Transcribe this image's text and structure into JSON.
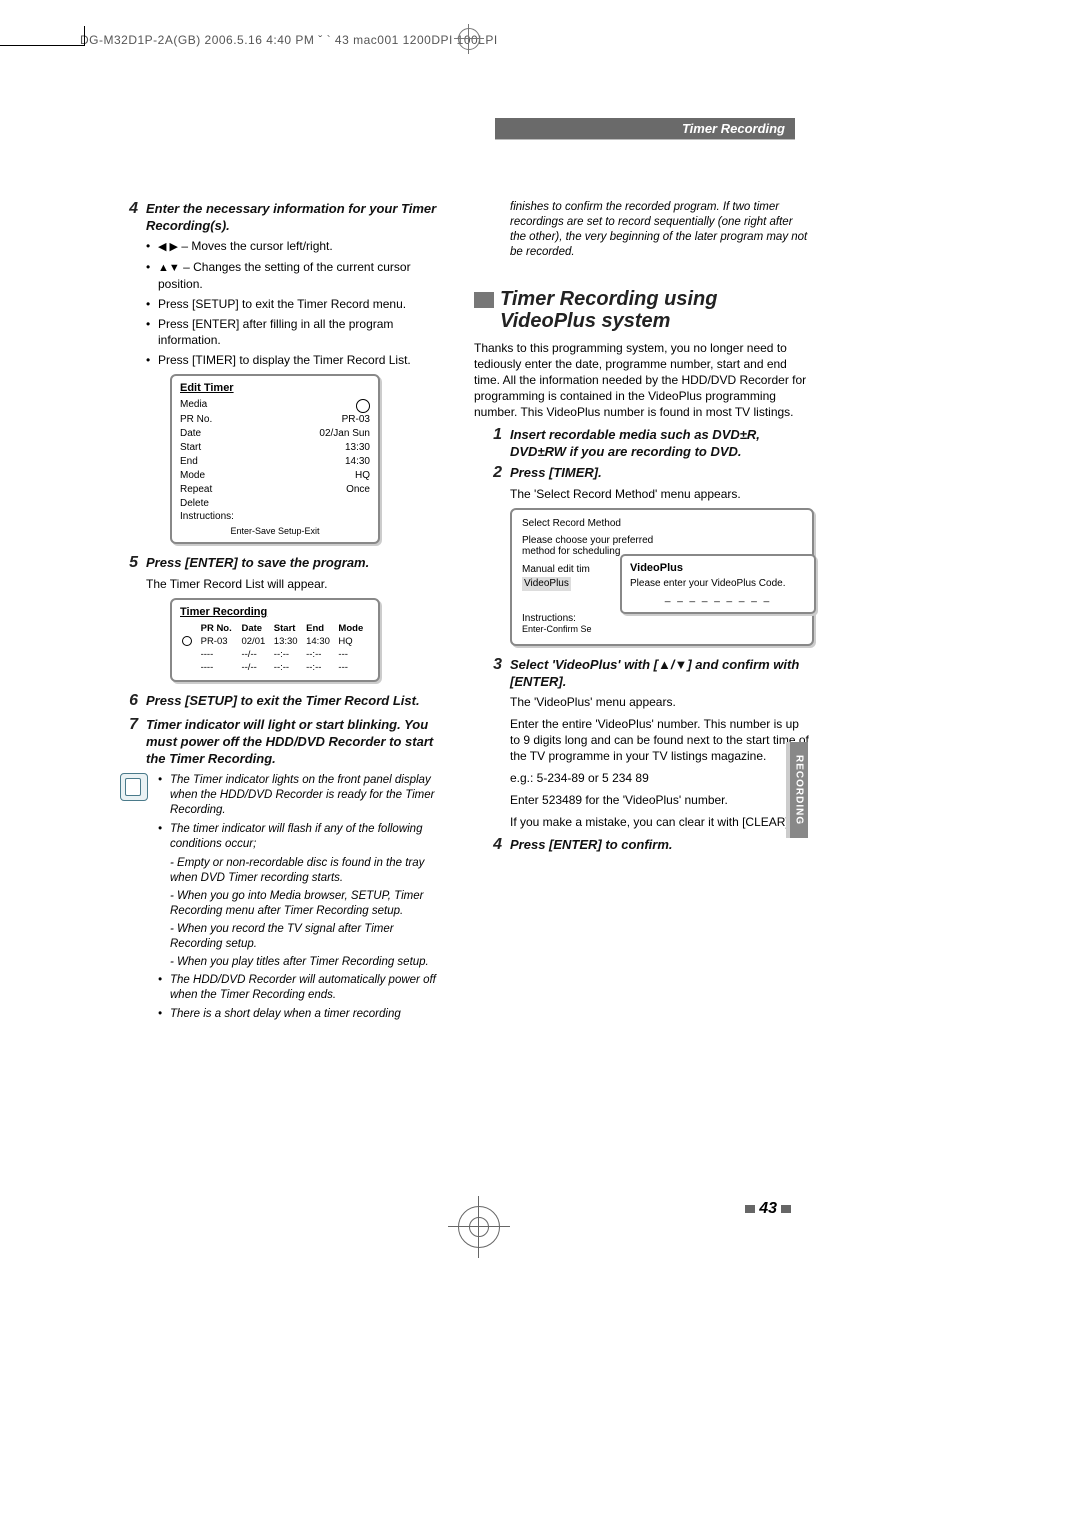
{
  "header": {
    "line": "DG-M32D1P-2A(GB)  2006.5.16 4:40 PM  ˇ  ` 43   mac001   1200DPI 100LPI",
    "section": "Timer Recording"
  },
  "left": {
    "step4": {
      "num": "4",
      "title": "Enter the necessary information for your Timer Recording(s).",
      "b1a": "◀ ▶",
      "b1b": "  – Moves the cursor left/right.",
      "b2a": "▲▼",
      "b2b": "  – Changes the setting of the current cursor position.",
      "b3": "Press [SETUP] to exit the Timer Record menu.",
      "b4": "Press [ENTER] after filling in all the program information.",
      "b5": "Press [TIMER] to display the Timer Record List."
    },
    "editTimer": {
      "title": "Edit Timer",
      "rows": {
        "media_l": "Media",
        "media_v": "",
        "pr_l": "PR No.",
        "pr_v": "PR-03",
        "date_l": "Date",
        "date_v": "02/Jan Sun",
        "start_l": "Start",
        "start_v": "13:30",
        "end_l": "End",
        "end_v": "14:30",
        "mode_l": "Mode",
        "mode_v": "HQ",
        "repeat_l": "Repeat",
        "repeat_v": "Once",
        "delete_l": "Delete"
      },
      "instr_l": "Instructions:",
      "instr": "Enter-Save  Setup-Exit"
    },
    "step5": {
      "num": "5",
      "title": "Press [ENTER] to save the program.",
      "body": "The Timer Record List will appear."
    },
    "timerRec": {
      "title": "Timer Recording",
      "head": {
        "pr": "PR No.",
        "date": "Date",
        "start": "Start",
        "end": "End",
        "mode": "Mode"
      },
      "r1": {
        "pr": "PR-03",
        "date": "02/01",
        "start": "13:30",
        "end": "14:30",
        "mode": "HQ"
      },
      "r2": {
        "pr": "----",
        "date": "--/--",
        "start": "--:--",
        "end": "--:--",
        "mode": "---"
      },
      "r3": {
        "pr": "----",
        "date": "--/--",
        "start": "--:--",
        "end": "--:--",
        "mode": "---"
      }
    },
    "step6": {
      "num": "6",
      "title": "Press [SETUP] to exit the Timer Record List."
    },
    "step7": {
      "num": "7",
      "title": "Timer indicator will light or start blinking. You must power off the HDD/DVD Recorder to start the Timer Recording."
    },
    "notes": {
      "n1": "The Timer indicator lights on the front panel display when the HDD/DVD Recorder is ready for the Timer Recording.",
      "n2": "The timer indicator will flash if any of the following conditions occur;",
      "d1": "- Empty or non-recordable disc is found in the tray when DVD Timer recording starts.",
      "d2": "- When you go into Media browser, SETUP, Timer Recording menu after Timer Recording setup.",
      "d3": "- When you record the TV signal after Timer Recording setup.",
      "d4": "- When you play titles after Timer Recording setup.",
      "n3": "The HDD/DVD Recorder will automatically power off when the Timer Recording ends.",
      "n4": "There is a short delay when a timer recording"
    }
  },
  "right": {
    "cont": "finishes to confirm the recorded program. If two timer recordings are set to record sequentially (one right after the other), the very beginning of the later program may not be recorded.",
    "h2": "Timer Recording using VideoPlus system",
    "intro": "Thanks to this programming system, you no longer need to tediously enter the date, programme number, start and end time. All the information needed by the HDD/DVD Recorder for programming is contained in the VideoPlus programming number. This VideoPlus number is found in most TV listings.",
    "step1": {
      "num": "1",
      "title": "Insert recordable media such as DVD±R, DVD±RW  if you are recording to DVD."
    },
    "step2": {
      "num": "2",
      "title": "Press [TIMER].",
      "body": "The 'Select Record Method' menu appears."
    },
    "selectBox": {
      "title": "Select Record Method",
      "line1": "Please choose your preferred",
      "line2": "method for scheduling",
      "opt1": "Manual edit tim",
      "opt2": "VideoPlus",
      "instr_l": "Instructions:",
      "instr": "Enter-Confirm  Se",
      "popTitle": "VideoPlus",
      "popBody": "Please enter your VideoPlus Code.",
      "popDash": "_ _ _ _ _ _ _ _ _"
    },
    "step3": {
      "num": "3",
      "title": "Select 'VideoPlus' with [▲/▼] and confirm with [ENTER].",
      "p1": "The 'VideoPlus' menu appears.",
      "p2": "Enter the entire 'VideoPlus' number. This number is up to 9 digits long and can be found next to the start time of the TV programme in your TV listings magazine.",
      "p3": "e.g.: 5-234-89 or 5 234 89",
      "p4": "Enter 523489 for the 'VideoPlus' number.",
      "p5": "If you make a mistake, you can clear it with [CLEAR]."
    },
    "step4": {
      "num": "4",
      "title": "Press [ENTER] to confirm."
    }
  },
  "sidetab": "RECORDING",
  "pagenum": "43"
}
